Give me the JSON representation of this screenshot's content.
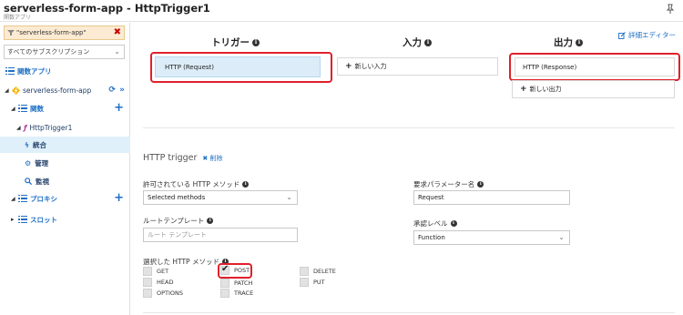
{
  "header": {
    "title": "serverless-form-app - HttpTrigger1",
    "subtitle": "関数アプリ"
  },
  "sidebar": {
    "search_value": "\"serverless-form-app\"",
    "subscription": "すべてのサブスクリプション",
    "function_apps": "関数アプリ",
    "app_name": "serverless-form-app",
    "functions": "関数",
    "trigger_name": "HttpTrigger1",
    "integrate": "統合",
    "manage": "管理",
    "monitor": "監視",
    "proxies": "プロキシ",
    "slots": "スロット"
  },
  "main": {
    "advanced_editor": "詳細エディター",
    "trigger_header": "トリガー",
    "input_header": "入力",
    "output_header": "出力",
    "trigger_box": "HTTP (Request)",
    "new_input": "新しい入力",
    "output_box": "HTTP (Response)",
    "new_output": "新しい出力",
    "section_title": "HTTP trigger",
    "delete": "削除",
    "allowed_methods_label": "許可されている HTTP メソッド",
    "allowed_methods_value": "Selected methods",
    "request_param_label": "要求パラメーター名",
    "request_param_value": "Request",
    "route_template_label": "ルートテンプレート",
    "route_template_placeholder": "ルート テンプレート",
    "auth_level_label": "承認レベル",
    "auth_level_value": "Function",
    "selected_methods_label": "選択した HTTP メソッド",
    "methods": [
      {
        "name": "GET",
        "checked": false
      },
      {
        "name": "HEAD",
        "checked": false
      },
      {
        "name": "OPTIONS",
        "checked": false
      },
      {
        "name": "POST",
        "checked": true
      },
      {
        "name": "PATCH",
        "checked": false
      },
      {
        "name": "TRACE",
        "checked": false
      },
      {
        "name": "DELETE",
        "checked": false
      },
      {
        "name": "PUT",
        "checked": false
      }
    ]
  },
  "colors": {
    "accent": "#1f6fc5",
    "highlight": "#e0202c",
    "selected_bg": "#dff0fb",
    "search_bg": "#fcebd2"
  }
}
